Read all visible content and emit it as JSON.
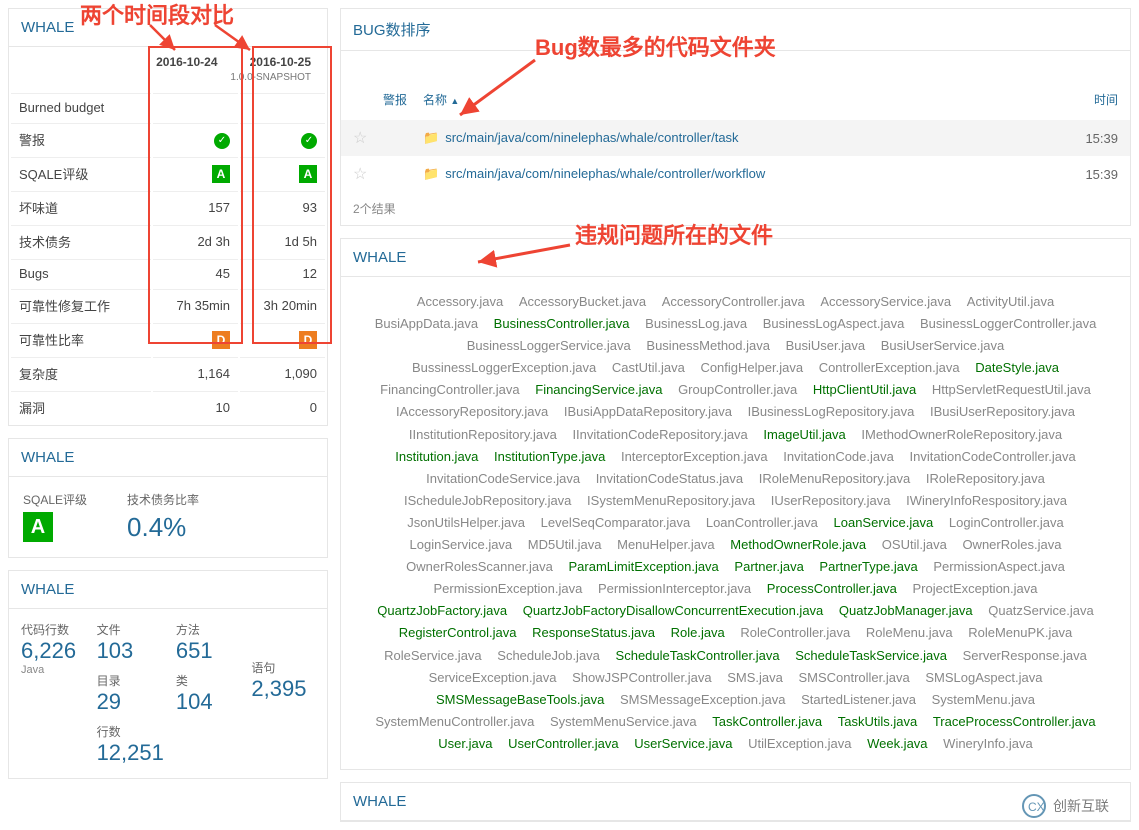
{
  "annotations": {
    "compare_label": "两个时间段对比",
    "most_bugs_label": "Bug数最多的代码文件夹",
    "violation_files_label": "违规问题所在的文件"
  },
  "left": {
    "whale_title": "WHALE",
    "dates": {
      "d1": "2016-10-24",
      "d2": "2016-10-25",
      "snapshot": "1.0.0-SNAPSHOT"
    },
    "rows": [
      {
        "label": "Burned budget",
        "v1": "",
        "v2": ""
      },
      {
        "label": "警报",
        "v1": "ok",
        "v2": "ok",
        "type": "ok"
      },
      {
        "label": "SQALE评级",
        "v1": "A",
        "v2": "A",
        "type": "A"
      },
      {
        "label": "坏味道",
        "v1": "157",
        "v2": "93"
      },
      {
        "label": "技术债务",
        "v1": "2d 3h",
        "v2": "1d 5h"
      },
      {
        "label": "Bugs",
        "v1": "45",
        "v2": "12"
      },
      {
        "label": "可靠性修复工作",
        "v1": "7h 35min",
        "v2": "3h 20min"
      },
      {
        "label": "可靠性比率",
        "v1": "D",
        "v2": "D",
        "type": "D"
      },
      {
        "label": "复杂度",
        "v1": "1,164",
        "v2": "1,090"
      },
      {
        "label": "漏洞",
        "v1": "10",
        "v2": "0"
      }
    ],
    "sqale_panel": {
      "title": "WHALE",
      "sqale_label": "SQALE评级",
      "sqale_value": "A",
      "debt_label": "技术债务比率",
      "debt_value": "0.4%"
    },
    "stats_panel": {
      "title": "WHALE",
      "loc_label": "代码行数",
      "loc_value": "6,226",
      "lang": "Java",
      "files_label": "文件",
      "files_value": "103",
      "dirs_label": "目录",
      "dirs_value": "29",
      "lines_label": "行数",
      "lines_value": "12,251",
      "methods_label": "方法",
      "methods_value": "651",
      "classes_label": "类",
      "classes_value": "104",
      "stmts_label": "语句",
      "stmts_value": "2,395"
    }
  },
  "right": {
    "bug_sort": {
      "title": "BUG数排序",
      "warn_header": "警报",
      "name_header": "名称",
      "time_header": "时间",
      "rows": [
        {
          "path": "src/main/java/com/ninelephas/whale/controller/task",
          "time": "15:39"
        },
        {
          "path": "src/main/java/com/ninelephas/whale/controller/workflow",
          "time": "15:39"
        }
      ],
      "count": "2个结果"
    },
    "violation": {
      "title": "WHALE",
      "files": [
        [
          "Accessory.java",
          "gray"
        ],
        [
          "AccessoryBucket.java",
          "gray"
        ],
        [
          "AccessoryController.java",
          "gray"
        ],
        [
          "AccessoryService.java",
          "gray"
        ],
        [
          "ActivityUtil.java",
          "gray"
        ],
        [
          "BusiAppData.java",
          "gray"
        ],
        [
          "BusinessController.java",
          "green"
        ],
        [
          "BusinessLog.java",
          "gray"
        ],
        [
          "BusinessLogAspect.java",
          "gray"
        ],
        [
          "BusinessLoggerController.java",
          "gray"
        ],
        [
          "BusinessLoggerService.java",
          "gray"
        ],
        [
          "BusinessMethod.java",
          "gray"
        ],
        [
          "BusiUser.java",
          "gray"
        ],
        [
          "BusiUserService.java",
          "gray"
        ],
        [
          "BussinessLoggerException.java",
          "gray"
        ],
        [
          "CastUtil.java",
          "gray"
        ],
        [
          "ConfigHelper.java",
          "gray"
        ],
        [
          "ControllerException.java",
          "gray"
        ],
        [
          "DateStyle.java",
          "green"
        ],
        [
          "FinancingController.java",
          "gray"
        ],
        [
          "FinancingService.java",
          "green"
        ],
        [
          "GroupController.java",
          "gray"
        ],
        [
          "HttpClientUtil.java",
          "green"
        ],
        [
          "HttpServletRequestUtil.java",
          "gray"
        ],
        [
          "IAccessoryRepository.java",
          "gray"
        ],
        [
          "IBusiAppDataRepository.java",
          "gray"
        ],
        [
          "IBusinessLogRepository.java",
          "gray"
        ],
        [
          "IBusiUserRepository.java",
          "gray"
        ],
        [
          "IInstitutionRepository.java",
          "gray"
        ],
        [
          "IInvitationCodeRepository.java",
          "gray"
        ],
        [
          "ImageUtil.java",
          "green"
        ],
        [
          "IMethodOwnerRoleRepository.java",
          "gray"
        ],
        [
          "Institution.java",
          "green"
        ],
        [
          "InstitutionType.java",
          "green"
        ],
        [
          "InterceptorException.java",
          "gray"
        ],
        [
          "InvitationCode.java",
          "gray"
        ],
        [
          "InvitationCodeController.java",
          "gray"
        ],
        [
          "InvitationCodeService.java",
          "gray"
        ],
        [
          "InvitationCodeStatus.java",
          "gray"
        ],
        [
          "IRoleMenuRepository.java",
          "gray"
        ],
        [
          "IRoleRepository.java",
          "gray"
        ],
        [
          "IScheduleJobRepository.java",
          "gray"
        ],
        [
          "ISystemMenuRepository.java",
          "gray"
        ],
        [
          "IUserRepository.java",
          "gray"
        ],
        [
          "IWineryInfoRespository.java",
          "gray"
        ],
        [
          "JsonUtilsHelper.java",
          "gray"
        ],
        [
          "LevelSeqComparator.java",
          "gray"
        ],
        [
          "LoanController.java",
          "gray"
        ],
        [
          "LoanService.java",
          "green"
        ],
        [
          "LoginController.java",
          "gray"
        ],
        [
          "LoginService.java",
          "gray"
        ],
        [
          "MD5Util.java",
          "gray"
        ],
        [
          "MenuHelper.java",
          "gray"
        ],
        [
          "MethodOwnerRole.java",
          "green"
        ],
        [
          "OSUtil.java",
          "gray"
        ],
        [
          "OwnerRoles.java",
          "gray"
        ],
        [
          "OwnerRolesScanner.java",
          "gray"
        ],
        [
          "ParamLimitException.java",
          "green"
        ],
        [
          "Partner.java",
          "green"
        ],
        [
          "PartnerType.java",
          "green"
        ],
        [
          "PermissionAspect.java",
          "gray"
        ],
        [
          "PermissionException.java",
          "gray"
        ],
        [
          "PermissionInterceptor.java",
          "gray"
        ],
        [
          "ProcessController.java",
          "green"
        ],
        [
          "ProjectException.java",
          "gray"
        ],
        [
          "QuartzJobFactory.java",
          "green"
        ],
        [
          "QuartzJobFactoryDisallowConcurrentExecution.java",
          "green"
        ],
        [
          "QuatzJobManager.java",
          "green"
        ],
        [
          "QuatzService.java",
          "gray"
        ],
        [
          "RegisterControl.java",
          "green"
        ],
        [
          "ResponseStatus.java",
          "green"
        ],
        [
          "Role.java",
          "green"
        ],
        [
          "RoleController.java",
          "gray"
        ],
        [
          "RoleMenu.java",
          "gray"
        ],
        [
          "RoleMenuPK.java",
          "gray"
        ],
        [
          "RoleService.java",
          "gray"
        ],
        [
          "ScheduleJob.java",
          "gray"
        ],
        [
          "ScheduleTaskController.java",
          "green"
        ],
        [
          "ScheduleTaskService.java",
          "green"
        ],
        [
          "ServerResponse.java",
          "gray"
        ],
        [
          "ServiceException.java",
          "gray"
        ],
        [
          "ShowJSPController.java",
          "gray"
        ],
        [
          "SMS.java",
          "gray"
        ],
        [
          "SMSController.java",
          "gray"
        ],
        [
          "SMSLogAspect.java",
          "gray"
        ],
        [
          "SMSMessageBaseTools.java",
          "green"
        ],
        [
          "SMSMessageException.java",
          "gray"
        ],
        [
          "StartedListener.java",
          "gray"
        ],
        [
          "SystemMenu.java",
          "gray"
        ],
        [
          "SystemMenuController.java",
          "gray"
        ],
        [
          "SystemMenuService.java",
          "gray"
        ],
        [
          "TaskController.java",
          "green"
        ],
        [
          "TaskUtils.java",
          "green"
        ],
        [
          "TraceProcessController.java",
          "green"
        ],
        [
          "User.java",
          "green"
        ],
        [
          "UserController.java",
          "green"
        ],
        [
          "UserService.java",
          "green"
        ],
        [
          "UtilException.java",
          "gray"
        ],
        [
          "Week.java",
          "green"
        ],
        [
          "WineryInfo.java",
          "gray"
        ]
      ]
    },
    "bottom_title": "WHALE",
    "logo_text": "创新互联"
  }
}
